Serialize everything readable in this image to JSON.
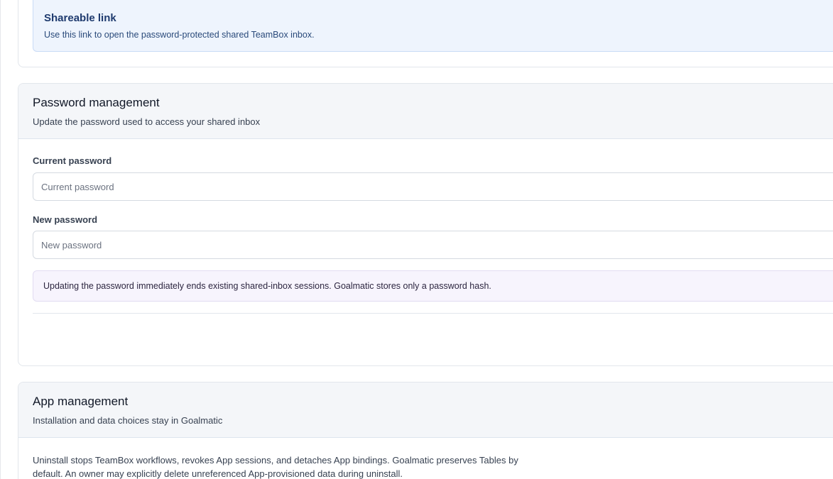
{
  "shareable_link": {
    "title": "Shareable link",
    "description": "Use this link to open the password-protected shared TeamBox inbox."
  },
  "password_management": {
    "title": "Password management",
    "subtitle": "Update the password used to access your shared inbox",
    "current_password": {
      "label": "Current password",
      "placeholder": "Current password",
      "value": ""
    },
    "new_password": {
      "label": "New password",
      "placeholder": "New password",
      "value": ""
    },
    "notice": "Updating the password immediately ends existing shared-inbox sessions. Goalmatic stores only a password hash."
  },
  "app_management": {
    "title": "App management",
    "subtitle": "Installation and data choices stay in Goalmatic",
    "description": "Uninstall stops TeamBox workflows, revokes App sessions, and detaches App bindings. Goalmatic preserves Tables by default. An owner may explicitly delete unreferenced App-provisioned data during uninstall."
  },
  "colors": {
    "share_box_bg": "#eef4fd",
    "share_title": "#1e3a6e",
    "notice_bg": "#f7f4fd",
    "card_header_bg": "#f4f6f9",
    "border": "#e2e6ec"
  }
}
